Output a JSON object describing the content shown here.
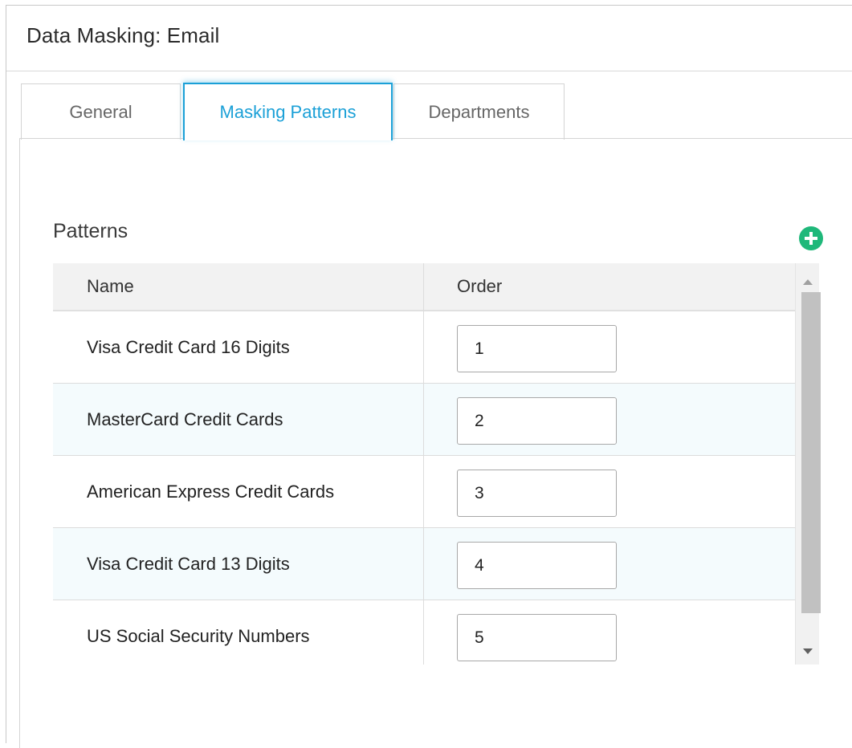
{
  "header": {
    "title": "Data Masking: Email"
  },
  "tabs": [
    {
      "label": "General",
      "active": false
    },
    {
      "label": "Masking Patterns",
      "active": true
    },
    {
      "label": "Departments",
      "active": false
    }
  ],
  "colors": {
    "accent": "#1ba0d7",
    "add_button": "#1fb87a",
    "alt_row": "#f4fbfd",
    "header_row": "#f2f2f2"
  },
  "patterns": {
    "label": "Patterns",
    "add_icon": "plus-circle-icon",
    "columns": [
      "Name",
      "Order"
    ],
    "rows": [
      {
        "name": "Visa Credit Card 16 Digits",
        "order": "1"
      },
      {
        "name": "MasterCard Credit Cards",
        "order": "2"
      },
      {
        "name": "American Express Credit Cards",
        "order": "3"
      },
      {
        "name": "Visa Credit Card 13 Digits",
        "order": "4"
      },
      {
        "name": "US Social Security Numbers",
        "order": "5"
      }
    ]
  },
  "scrollbar": {
    "up_icon": "arrow-up-icon",
    "down_icon": "arrow-down-icon"
  }
}
